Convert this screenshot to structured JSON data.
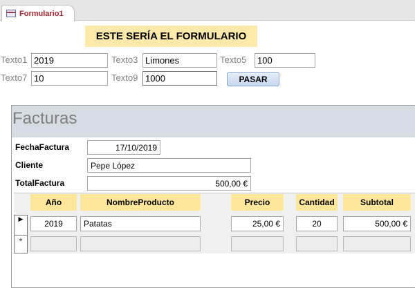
{
  "tab": {
    "title": "Formulario1",
    "icon": "form-icon"
  },
  "banner": "ESTE SERÍA EL FORMULARIO",
  "fields": [
    {
      "label": "Texto1",
      "value": "2019"
    },
    {
      "label": "Texto3",
      "value": "Limones"
    },
    {
      "label": "Texto5",
      "value": "100"
    },
    {
      "label": "Texto7",
      "value": "10"
    },
    {
      "label": "Texto9",
      "value": "1000"
    }
  ],
  "button": "PASAR",
  "subform": {
    "title": "Facturas",
    "fecha_label": "FechaFactura",
    "fecha_value": "17/10/2019",
    "cliente_label": "Cliente",
    "cliente_value": "Pepe López",
    "total_label": "TotalFactura",
    "total_value": "500,00 €",
    "columns": [
      "Año",
      "NombreProducto",
      "Precio",
      "Cantidad",
      "Subtotal"
    ],
    "rows": [
      [
        "2019",
        "Patatas",
        "25,00 €",
        "20",
        "500,00 €"
      ]
    ],
    "new_row_marker": "*",
    "current_row_marker": "▶"
  }
}
